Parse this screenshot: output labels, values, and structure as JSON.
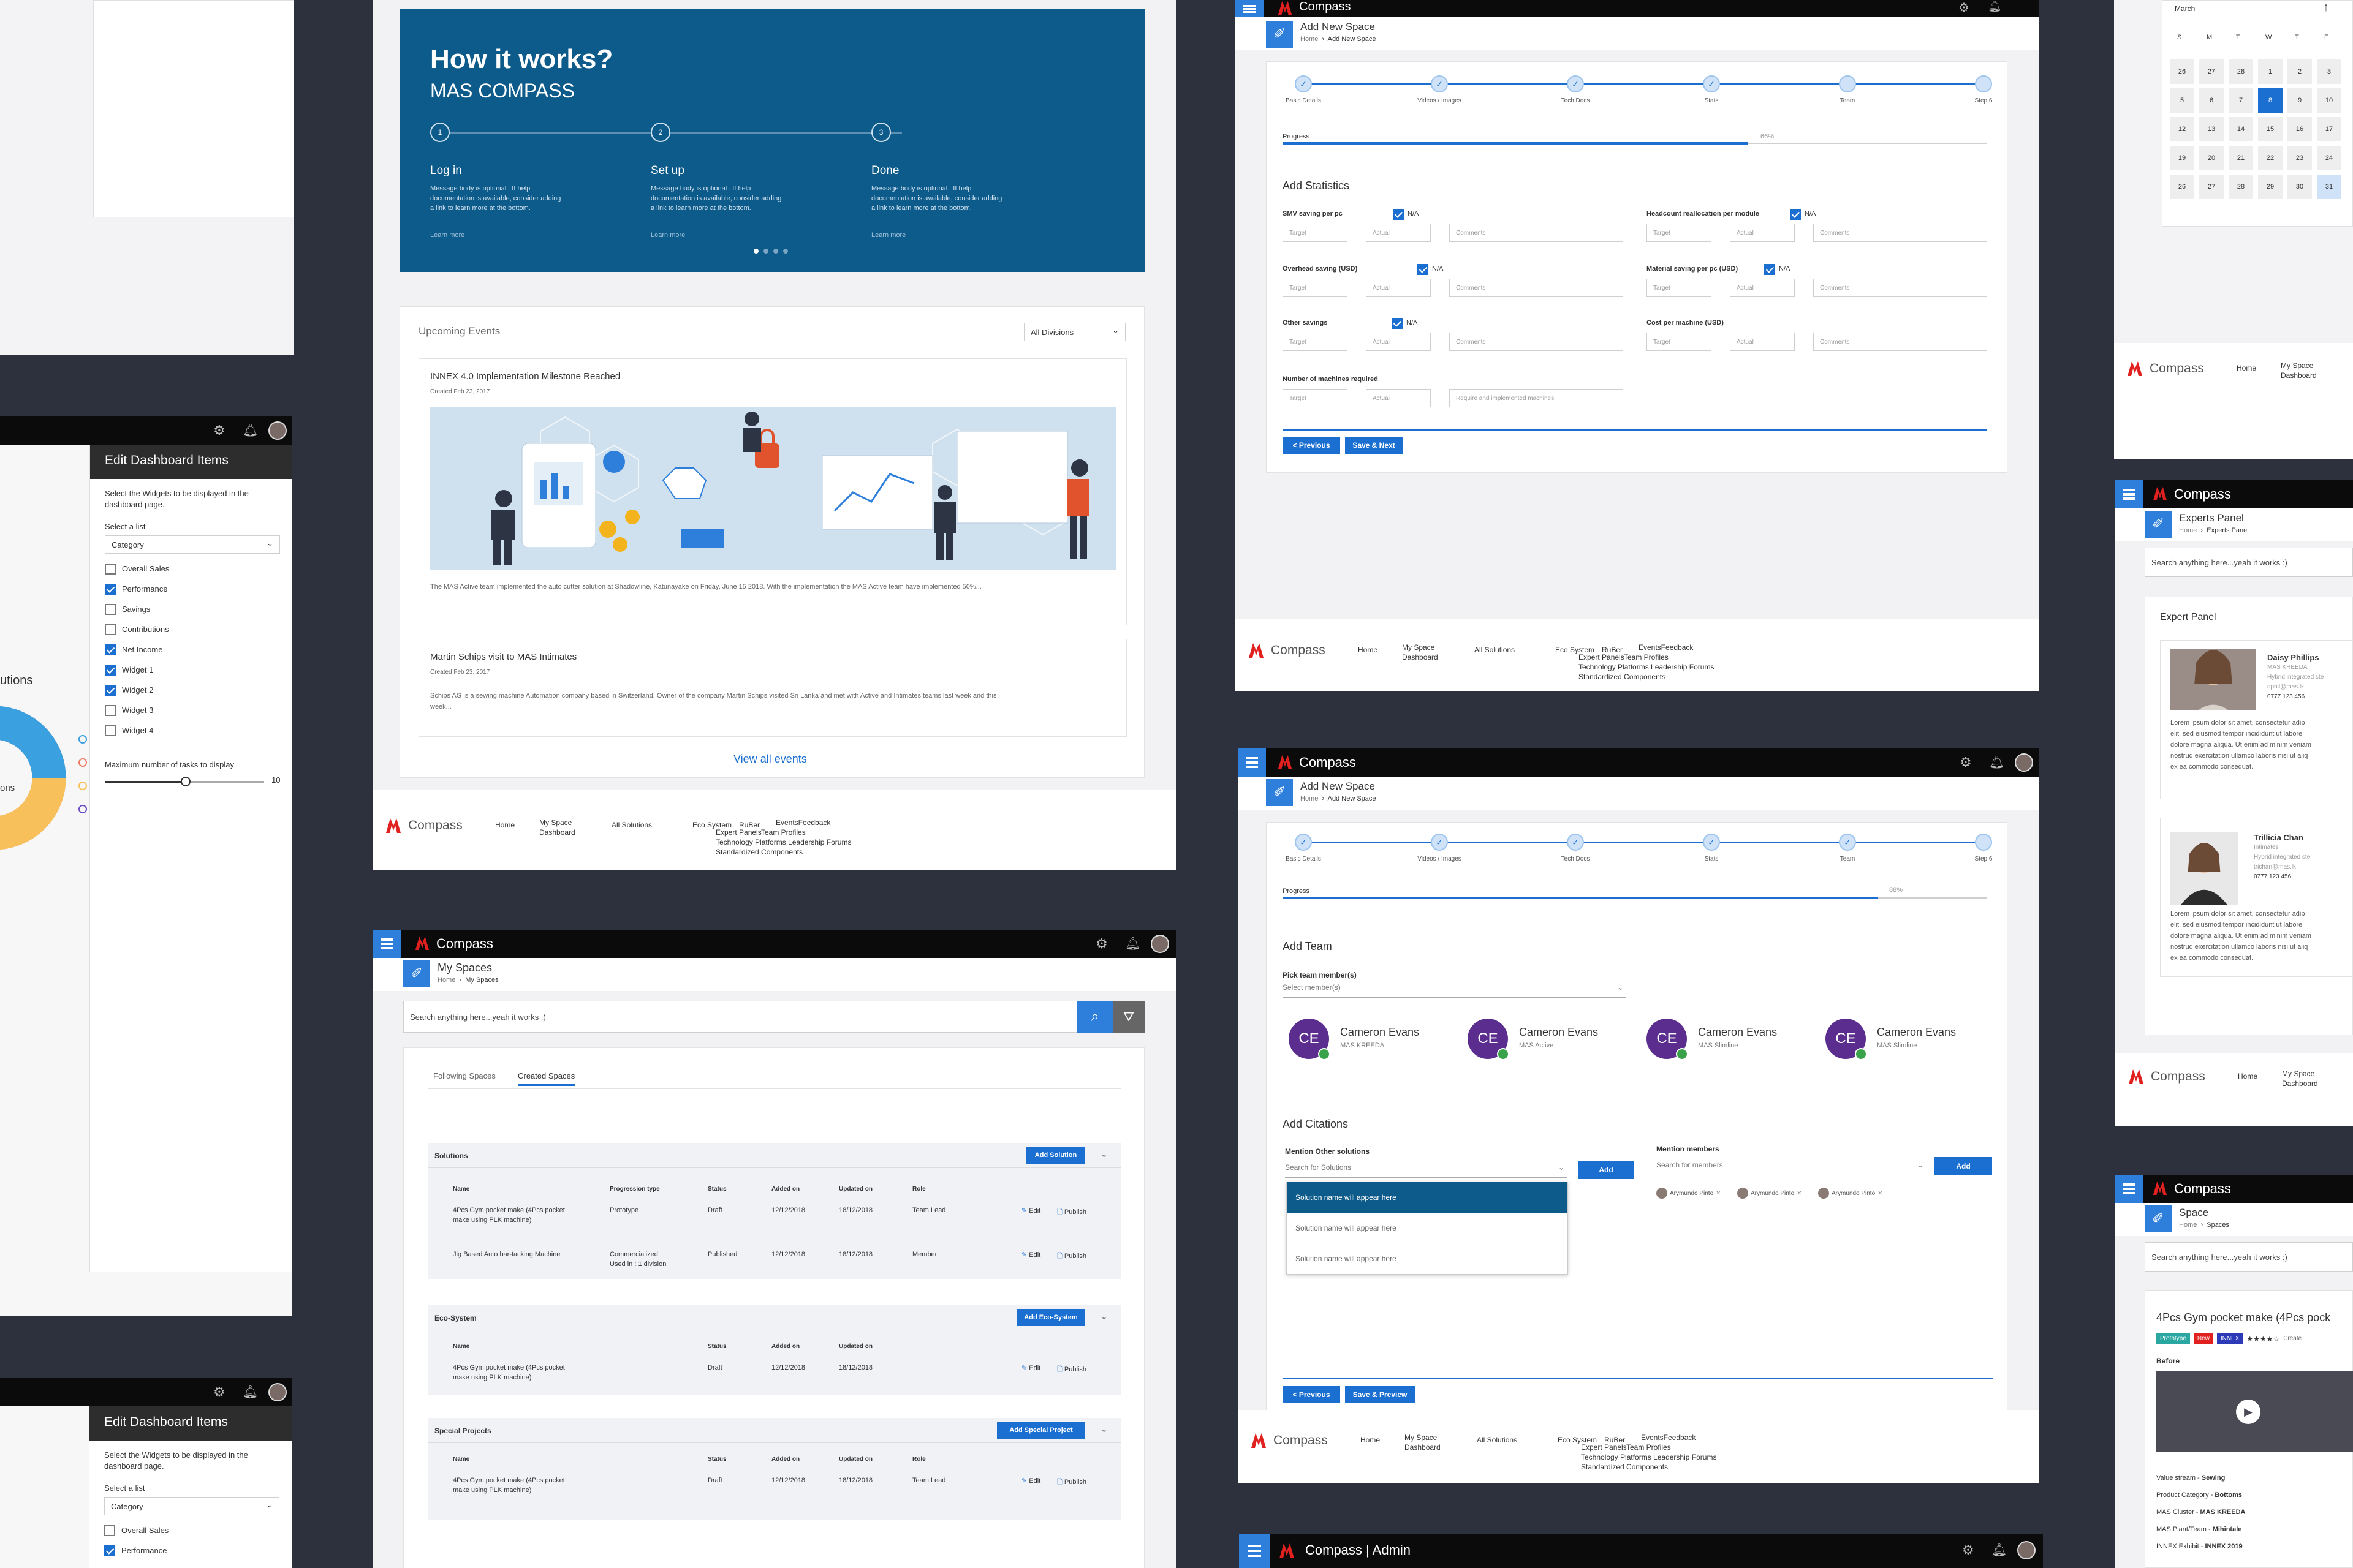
{
  "brand": {
    "name": "Compass",
    "admin_name": "Compass | Admin",
    "accent": "#1a6fd0",
    "dark_bar": "#0b0b0b",
    "hero_bg": "#0d5b8a",
    "logo_red": "#e0211f"
  },
  "footer": {
    "logo": "Compass",
    "links": [
      "Home",
      "My Space Dashboard",
      "All Solutions",
      "Eco System",
      "RuBer",
      "EventsFeedback",
      "Expert Panels",
      "Team Profiles",
      "Technology Platforms",
      "Leadership Forums",
      "Standardized Components"
    ],
    "home": "Home",
    "my_space": "My Space",
    "dashboard": "Dashboard",
    "all_solutions": "All Solutions",
    "eco_system": "Eco System",
    "ruber": "RuBer",
    "events_feedback": "EventsFeedback",
    "expert_panels": "Expert Panels",
    "team_profiles": "Team Profiles",
    "tech_line": "Technology Platforms Leadership Forums",
    "standardized": "Standardized Components"
  },
  "how": {
    "title": "How it works?",
    "subtitle": "MAS COMPASS",
    "steps": [
      {
        "num": "1",
        "title": "Log in",
        "body1": "Message body is optional . If help",
        "body2": "documentation is available, consider adding",
        "body3": "a link to learn more at the bottom.",
        "link": "Learn more"
      },
      {
        "num": "2",
        "title": "Set up",
        "body1": "Message body is optional . If help",
        "body2": "documentation is available, consider adding",
        "body3": "a link to learn more at the bottom.",
        "link": "Learn more"
      },
      {
        "num": "3",
        "title": "Done",
        "body1": "Message body is optional . If help",
        "body2": "documentation is available, consider adding",
        "body3": "a link to learn more at the bottom.",
        "link": "Learn more"
      }
    ]
  },
  "events": {
    "title": "Upcoming Events",
    "filter": "All Divisions",
    "items": [
      {
        "title": "INNEX 4.0 Implementation Milestone Reached",
        "date": "Created Feb 23, 2017",
        "body": "The MAS Active team implemented the auto cutter solution at Shadowline, Katunayake on Friday, June 15 2018. With the implementation the MAS Active team have implemented 50%..."
      },
      {
        "title": "Martin Schips visit to MAS Intimates",
        "date": "Created Feb 23, 2017",
        "body1": "Schips AG is a sewing machine Automation company based in Switzerland. Owner of the company Martin Schips visited Sri Lanka and met with Active and Intimates teams last week and this",
        "body2": "week..."
      }
    ],
    "view_all": "View all events"
  },
  "dash": {
    "title": "Edit Dashboard Items",
    "desc1": "Select the Widgets to be displayed in the",
    "desc2": "dashboard page.",
    "select_label": "Select a list",
    "select_value": "Category",
    "items": [
      {
        "label": "Overall Sales",
        "on": false
      },
      {
        "label": "Performance",
        "on": true
      },
      {
        "label": "Savings",
        "on": false
      },
      {
        "label": "Contributions",
        "on": false
      },
      {
        "label": "Net Income",
        "on": true
      },
      {
        "label": "Widget 1",
        "on": true
      },
      {
        "label": "Widget 2",
        "on": true
      },
      {
        "label": "Widget 3",
        "on": false
      },
      {
        "label": "Widget 4",
        "on": false
      }
    ],
    "max_label": "Maximum number of tasks to display",
    "max_value": "10",
    "side_text": "utions",
    "side_text2": "ons"
  },
  "dash2": {
    "items": [
      {
        "label": "Overall Sales",
        "on": false
      },
      {
        "label": "Performance",
        "on": true
      }
    ]
  },
  "myspaces": {
    "page": "My Spaces",
    "crumb_home": "Home",
    "crumb_here": "My Spaces",
    "search_placeholder": "Search anything here...yeah it works :)",
    "tabs": [
      "Following Spaces",
      "Created Spaces"
    ],
    "solutions": {
      "title": "Solutions",
      "add": "Add Solution",
      "cols": [
        "Name",
        "Progression type",
        "Status",
        "Added on",
        "Updated on",
        "Role"
      ],
      "rows": [
        {
          "name1": "4Pcs Gym pocket make (4Pcs pocket",
          "name2": "make using PLK machine)",
          "type": "Prototype",
          "status": "Draft",
          "added": "12/12/2018",
          "updated": "18/12/2018",
          "role": "Team Lead"
        },
        {
          "name1": "Jig Based Auto bar-tacking Machine",
          "name2": "",
          "type": "Commercialized",
          "type2": "Used in : 1 division",
          "status": "Published",
          "added": "12/12/2018",
          "updated": "18/12/2018",
          "role": "Member"
        }
      ]
    },
    "eco": {
      "title": "Eco-System",
      "add": "Add Eco-System",
      "cols": [
        "Name",
        "Status",
        "Added on",
        "Updated on"
      ],
      "rows": [
        {
          "name1": "4Pcs Gym pocket make (4Pcs pocket",
          "name2": "make using PLK machine)",
          "status": "Draft",
          "added": "12/12/2018",
          "updated": "18/12/2018"
        }
      ]
    },
    "special": {
      "title": "Special Projects",
      "add": "Add Special Project",
      "cols": [
        "Name",
        "Status",
        "Added on",
        "Updated on",
        "Role"
      ],
      "rows": [
        {
          "name1": "4Pcs Gym pocket make (4Pcs pocket",
          "name2": "make using PLK machine)",
          "status": "Draft",
          "added": "12/12/2018",
          "updated": "18/12/2018",
          "role": "Team Lead"
        }
      ]
    },
    "edit": "Edit",
    "publish": "Publish"
  },
  "wizard": {
    "page": "Add New Space",
    "crumb_home": "Home",
    "crumb_here": "Add New Space",
    "steps": [
      "Basic Details",
      "Videos / Images",
      "Tech Docs",
      "Stats",
      "Team",
      "Step 6"
    ],
    "progress_label": "Progress",
    "progress1": "66%",
    "progress2": "88%",
    "stats_title": "Add Statistics",
    "na": "N/A",
    "target": "Target",
    "actual": "Actual",
    "comments": "Comments",
    "left_fields": [
      "SMV saving per pc",
      "Overhead saving (USD)",
      "Other savings",
      "Number of machines required"
    ],
    "right_fields": [
      "Headcount reallocation per module",
      "Material saving per pc (USD)",
      "Cost per machine (USD)"
    ],
    "machines_comment": "Require and implemented machines",
    "prev": "< Previous",
    "save_next": "Save & Next",
    "save_preview": "Save & Preview",
    "team_title": "Add Team",
    "pick_label": "Pick team member(s)",
    "pick_placeholder": "Select member(s)",
    "members": [
      {
        "initials": "CE",
        "name": "Cameron Evans",
        "unit": "MAS KREEDA"
      },
      {
        "initials": "CE",
        "name": "Cameron Evans",
        "unit": "MAS Active"
      },
      {
        "initials": "CE",
        "name": "Cameron Evans",
        "unit": "MAS Slimline"
      },
      {
        "initials": "CE",
        "name": "Cameron Evans",
        "unit": "MAS Slimline"
      }
    ],
    "cit_title": "Add Citations",
    "mention_sol": "Mention Other solutions",
    "search_sol": "Search for Solutions",
    "add": "Add",
    "mention_mem": "Mention members",
    "search_mem": "Search for members",
    "options": [
      "Solution name will appear here",
      "Solution name will appear here",
      "Solution name will appear here"
    ],
    "chips": [
      "Arymundo Pinto",
      "Arymundo Pinto",
      "Arymundo Pinto"
    ]
  },
  "calendar": {
    "month": "March",
    "days": [
      "S",
      "M",
      "T",
      "W",
      "T",
      "F",
      "S"
    ],
    "rows": [
      [
        "26",
        "27",
        "28",
        "1",
        "2",
        "3"
      ],
      [
        "5",
        "6",
        "7",
        "8",
        "9",
        "10"
      ],
      [
        "12",
        "13",
        "14",
        "15",
        "16",
        "17"
      ],
      [
        "19",
        "20",
        "21",
        "22",
        "23",
        "24"
      ],
      [
        "26",
        "27",
        "28",
        "29",
        "30",
        "31"
      ]
    ]
  },
  "experts": {
    "page": "Experts Panel",
    "crumb_home": "Home",
    "crumb_here": "Experts Panel",
    "search": "Search anything here...yeah it works :)",
    "panel_title": "Expert Panel",
    "people": [
      {
        "name": "Daisy Phillips",
        "unit": "MAS KREEDA",
        "line1": "Hybrid integrated ste",
        "email": "dphil@mas.lk",
        "phone": "0777 123 456"
      },
      {
        "name": "Trillicia Chan",
        "unit": "Intimates",
        "line1": "Hybrid integrated ste",
        "email": "trichan@mas.lk",
        "phone": "0777 123 456"
      }
    ],
    "bio": [
      "Lorem ipsum dolor sit amet, consectetur adip",
      "elit, sed  eiusmod tempor incididunt ut labore",
      "dolore  magna aliqua. Ut enim ad minim veniam",
      "nostrud exercitation ullamco laboris nisi ut aliq",
      "ex ea commodo consequat."
    ]
  },
  "space": {
    "page": "Space",
    "crumb_home": "Home",
    "crumb_here": "Spaces",
    "search": "Search anything here...yeah it works :)",
    "title": "4Pcs Gym pocket make (4Pcs pock",
    "badges": [
      "Prototype",
      "New",
      "INNEX"
    ],
    "stars": "★★★★☆",
    "created": "Create",
    "before": "Before",
    "meta": [
      [
        "Value stream - ",
        "Sewing"
      ],
      [
        "Product Category - ",
        "Bottoms"
      ],
      [
        "MAS Cluster - ",
        "MAS KREEDA"
      ],
      [
        "MAS Plant/Team - ",
        "Mihintale"
      ],
      [
        "INNEX Exhibit - ",
        "INNEX 2019"
      ]
    ]
  }
}
